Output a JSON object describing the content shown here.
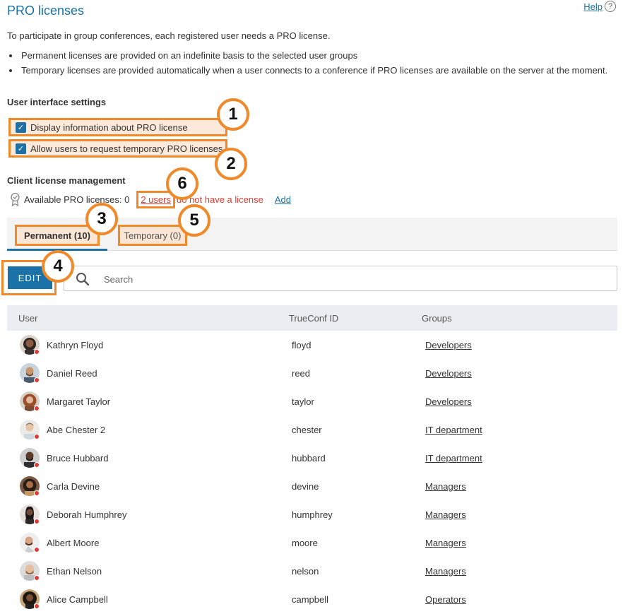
{
  "header": {
    "title": "PRO licenses",
    "help_label": "Help",
    "help_icon": "?"
  },
  "intro": "To participate in group conferences, each registered user needs a PRO license.",
  "bullets": [
    "Permanent licenses are provided on an indefinite basis to the selected user groups",
    "Temporary licenses are provided automatically when a user connects to a conference if PRO licenses are available on the server at the moment."
  ],
  "ui_settings": {
    "title": "User interface settings",
    "options": [
      {
        "label": "Display information about PRO license",
        "checked": true
      },
      {
        "label": "Allow users to request temporary PRO licenses",
        "checked": true
      }
    ]
  },
  "client_license": {
    "title": "Client license management",
    "available_label": "Available PRO licenses: 0",
    "users_link": "2 users",
    "no_license_text": "do not have a license",
    "add_label": "Add"
  },
  "tabs": [
    {
      "label": "Permanent (10)",
      "active": true
    },
    {
      "label": "Temporary (0)",
      "active": false
    }
  ],
  "toolbar": {
    "edit_label": "EDIT",
    "search_placeholder": "Search"
  },
  "table": {
    "columns": [
      "User",
      "TrueConf ID",
      "Groups"
    ],
    "rows": [
      {
        "name": "Kathryn Floyd",
        "id": "floyd",
        "group": "Developers"
      },
      {
        "name": "Daniel Reed",
        "id": "reed",
        "group": "Developers"
      },
      {
        "name": "Margaret Taylor",
        "id": "taylor",
        "group": "Developers"
      },
      {
        "name": "Abe Chester 2",
        "id": "chester",
        "group": "IT department"
      },
      {
        "name": "Bruce Hubbard",
        "id": "hubbard",
        "group": "IT department"
      },
      {
        "name": "Carla Devine",
        "id": "devine",
        "group": "Managers"
      },
      {
        "name": "Deborah Humphrey",
        "id": "humphrey",
        "group": "Managers"
      },
      {
        "name": "Albert Moore",
        "id": "moore",
        "group": "Managers"
      },
      {
        "name": "Ethan Nelson",
        "id": "nelson",
        "group": "Managers"
      },
      {
        "name": "Alice Campbell",
        "id": "campbell",
        "group": "Operators"
      }
    ]
  },
  "callouts": [
    "1",
    "2",
    "3",
    "4",
    "5",
    "6"
  ],
  "colors": {
    "accent": "#1a72a8",
    "highlight": "#f0892a",
    "alert": "#e03b30",
    "status_dot": "#e53935"
  }
}
